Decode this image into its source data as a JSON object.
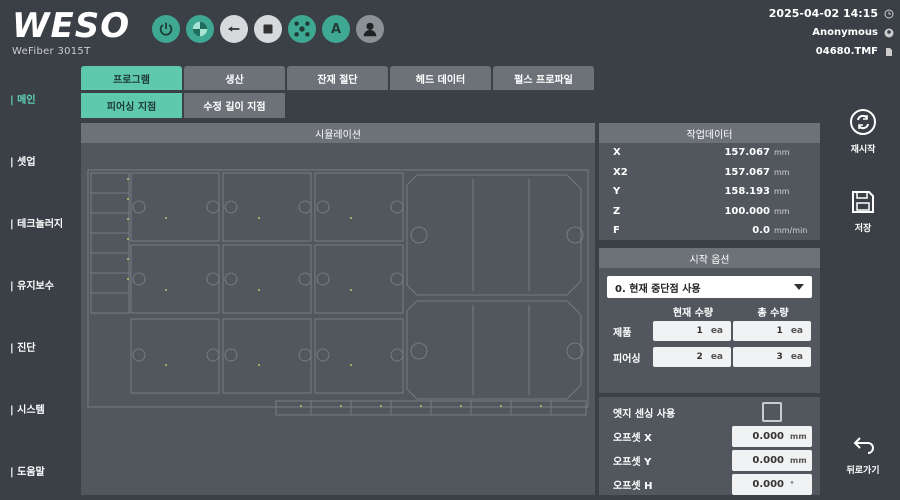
{
  "header": {
    "logo": "WESO",
    "model": "WeFiber 3015T",
    "datetime": "2025-04-02 14:15",
    "user": "Anonymous",
    "file": "04680.TMF",
    "tool_icons": [
      "power-icon",
      "quadrant-icon",
      "arrow-left-circle-icon",
      "stop-icon",
      "network-icon",
      "auto-icon",
      "user-icon"
    ],
    "auto_letter": "A"
  },
  "nav": {
    "items": [
      "| 메인",
      "| 셋업",
      "| 테크놀러지",
      "| 유지보수",
      "| 진단",
      "| 시스템",
      "| 도움말"
    ]
  },
  "tabs": [
    "프로그램",
    "생산",
    "잔재 절단",
    "헤드 데이터",
    "펄스 프로파일"
  ],
  "subtabs": [
    "피어싱 지점",
    "수정 길이 지점"
  ],
  "simulation": {
    "title": "시뮬레이션"
  },
  "work_data": {
    "title": "작업데이터",
    "rows": [
      {
        "label": "X",
        "value": "157.067",
        "unit": "mm"
      },
      {
        "label": "X2",
        "value": "157.067",
        "unit": "mm"
      },
      {
        "label": "Y",
        "value": "158.193",
        "unit": "mm"
      },
      {
        "label": "Z",
        "value": "100.000",
        "unit": "mm"
      },
      {
        "label": "F",
        "value": "0.0",
        "unit": "mm/min"
      }
    ]
  },
  "start_options": {
    "title": "시작 옵션",
    "dropdown": "0. 현재 중단점 사용",
    "col_current": "현재 수량",
    "col_total": "총 수량",
    "rows": [
      {
        "label": "제품",
        "current": "1",
        "total": "1",
        "unit": "ea"
      },
      {
        "label": "피어싱",
        "current": "2",
        "total": "3",
        "unit": "ea"
      }
    ]
  },
  "edge": {
    "label": "엣지 센싱 사용",
    "offsets": [
      {
        "label": "오프셋 X",
        "value": "0.000",
        "unit": "mm"
      },
      {
        "label": "오프셋 Y",
        "value": "0.000",
        "unit": "mm"
      },
      {
        "label": "오프셋 H",
        "value": "0.000",
        "unit": "°"
      }
    ]
  },
  "actions": {
    "restart": "재시작",
    "save": "저장",
    "back": "뒤로가기"
  },
  "colors": {
    "accent": "#5fc9ae",
    "panel": "#52575d",
    "background": "#3b4046"
  }
}
